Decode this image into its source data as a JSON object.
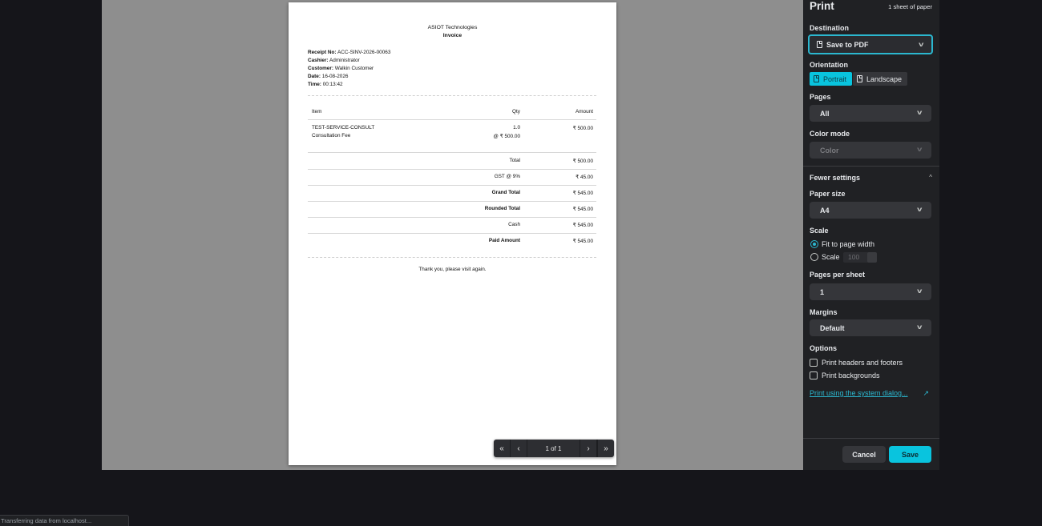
{
  "receipt": {
    "company": "ASIOT Technologies",
    "title": "Invoice",
    "meta": [
      {
        "label": "Receipt No:",
        "value": "ACC-SINV-2026-00063"
      },
      {
        "label": "Cashier:",
        "value": "Administrator"
      },
      {
        "label": "Customer:",
        "value": "Walkin Customer"
      },
      {
        "label": "Date:",
        "value": "16-08-2026"
      },
      {
        "label": "Time:",
        "value": "00:13:42"
      }
    ],
    "columns": {
      "item": "Item",
      "qty": "Qty",
      "amount": "Amount"
    },
    "items": [
      {
        "code": "TEST-SERVICE-CONSULT",
        "name": "Consultation Fee",
        "qty": "1.0",
        "rate": "@ ₹ 500.00",
        "amount": "₹ 500.00"
      }
    ],
    "totals": [
      {
        "label": "Total",
        "value": "₹ 500.00",
        "bold": false
      },
      {
        "label": "GST @ 9%",
        "value": "₹ 45.00",
        "bold": false
      },
      {
        "label": "Grand Total",
        "value": "₹ 545.00",
        "bold": true
      },
      {
        "label": "Rounded Total",
        "value": "₹ 545.00",
        "bold": true
      },
      {
        "label": "Cash",
        "value": "₹ 545.00",
        "bold": false
      },
      {
        "label": "Paid Amount",
        "value": "₹ 545.00",
        "bold": true
      }
    ],
    "footer": "Thank you, please visit again."
  },
  "pager": {
    "first": "«",
    "prev": "‹",
    "page_label": "1 of 1",
    "next": "›",
    "last": "»"
  },
  "print_panel": {
    "title": "Print",
    "sheet_count": "1 sheet of paper",
    "destination": {
      "label": "Destination",
      "value": "Save to PDF"
    },
    "orientation": {
      "label": "Orientation",
      "portrait": "Portrait",
      "landscape": "Landscape",
      "selected": "Portrait"
    },
    "pages": {
      "label": "Pages",
      "value": "All"
    },
    "color_mode": {
      "label": "Color mode",
      "value": "Color"
    },
    "fewer_settings": "Fewer settings",
    "paper_size": {
      "label": "Paper size",
      "value": "A4"
    },
    "scale": {
      "label": "Scale",
      "fit_option": "Fit to page width",
      "scale_option": "Scale",
      "scale_value": "100",
      "selected": "Fit to page width"
    },
    "pages_per_sheet": {
      "label": "Pages per sheet",
      "value": "1"
    },
    "margins": {
      "label": "Margins",
      "value": "Default"
    },
    "options": {
      "label": "Options",
      "headers_footers": "Print headers and footers",
      "backgrounds": "Print backgrounds"
    },
    "system_dialog_link": "Print using the system dialog...",
    "cancel": "Cancel",
    "save": "Save"
  },
  "colors": {
    "accent": "#09c4de",
    "panel_bg": "#202124",
    "preview_bg": "#8e8e8e"
  },
  "status_bar": "Transferring data from localhost..."
}
